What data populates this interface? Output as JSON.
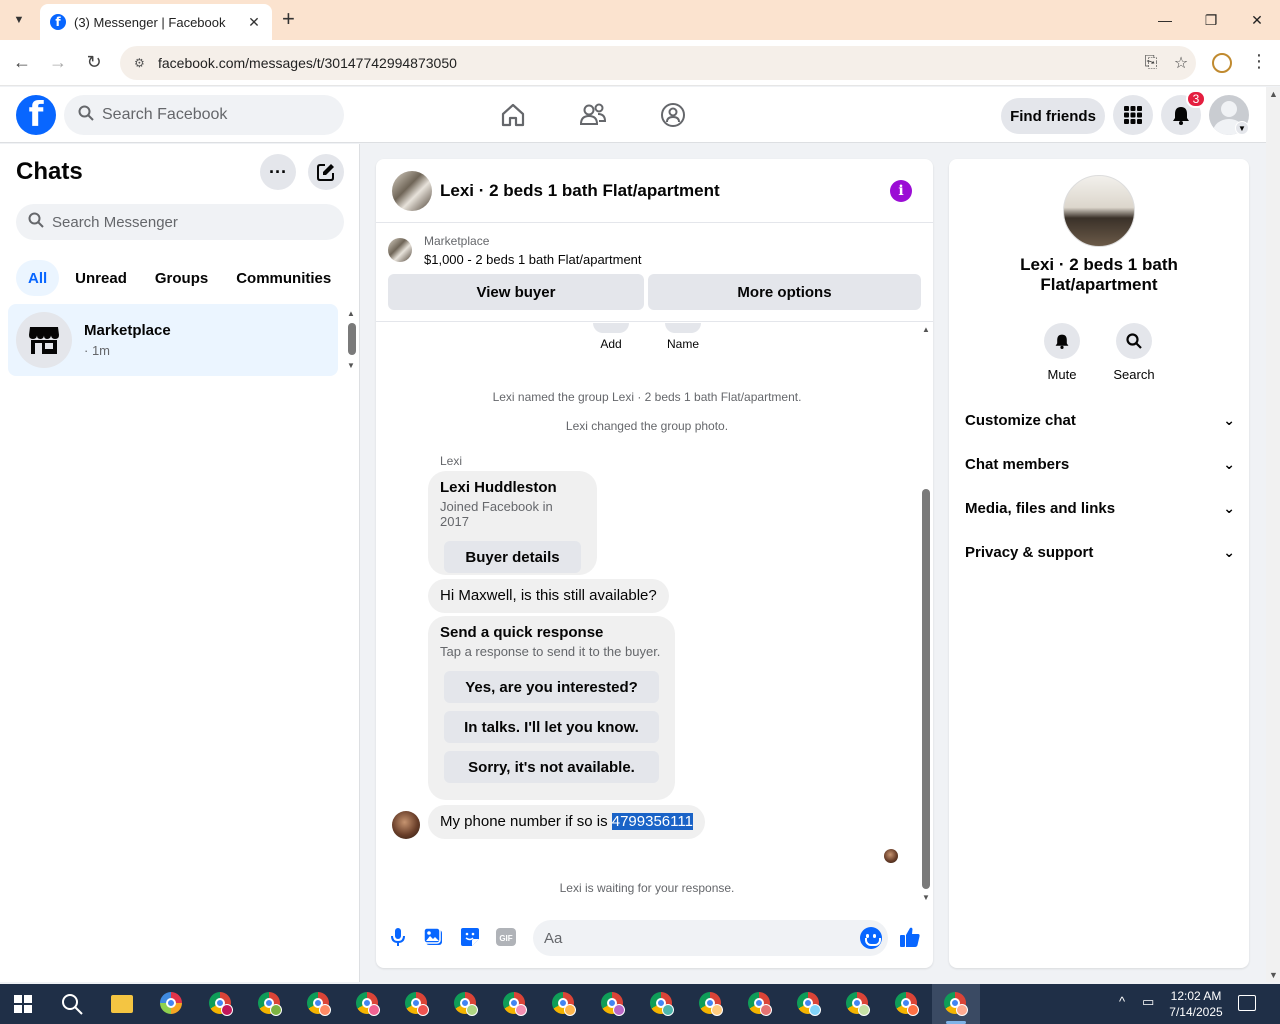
{
  "browser": {
    "tab_title": "(3) Messenger | Facebook",
    "url": "facebook.com/messages/t/30147742994873050"
  },
  "fb_header": {
    "search_placeholder": "Search Facebook",
    "find_friends_label": "Find friends",
    "notification_count": "3"
  },
  "sidebar": {
    "title": "Chats",
    "search_placeholder": "Search Messenger",
    "filters": [
      "All",
      "Unread",
      "Groups",
      "Communities"
    ],
    "chat_items": [
      {
        "name": "Marketplace",
        "sub": "· 1m"
      }
    ]
  },
  "conversation": {
    "title": "Lexi · 2 beds 1 bath Flat/apartment",
    "marketplace_label": "Marketplace",
    "listing": "$1,000 - 2 beds 1 bath Flat/apartment",
    "view_buyer_label": "View buyer",
    "more_options_label": "More options",
    "partial_actions": [
      "Add",
      "Name"
    ],
    "system_messages": [
      "Lexi named the group Lexi · 2 beds 1 bath Flat/apartment.",
      "Lexi changed the group photo."
    ],
    "sender_name": "Lexi",
    "buyer_card": {
      "name": "Lexi Huddleston",
      "joined": "Joined Facebook in 2017",
      "button": "Buyer details"
    },
    "message_1": "Hi Maxwell, is this still available?",
    "quick_response": {
      "title": "Send a quick response",
      "subtitle": "Tap a response to send it to the buyer.",
      "options": [
        "Yes, are you interested?",
        "In talks. I'll let you know.",
        "Sorry, it's not available."
      ]
    },
    "message_2_prefix": "My phone number if so is ",
    "message_2_phone": "4799356111",
    "waiting_text": "Lexi is waiting for your response.",
    "composer_placeholder": "Aa"
  },
  "right_panel": {
    "name": "Lexi · 2 beds 1 bath Flat/apartment",
    "actions": [
      "Mute",
      "Search"
    ],
    "sections": [
      "Customize chat",
      "Chat members",
      "Media, files and links",
      "Privacy & support"
    ]
  },
  "taskbar": {
    "time": "12:02 AM",
    "date": "7/14/2025"
  },
  "colors": {
    "fb_blue": "#0866ff",
    "info_purple": "#9b0dd5",
    "selection": "#1a63c7",
    "badge_red": "#e41e3f"
  }
}
